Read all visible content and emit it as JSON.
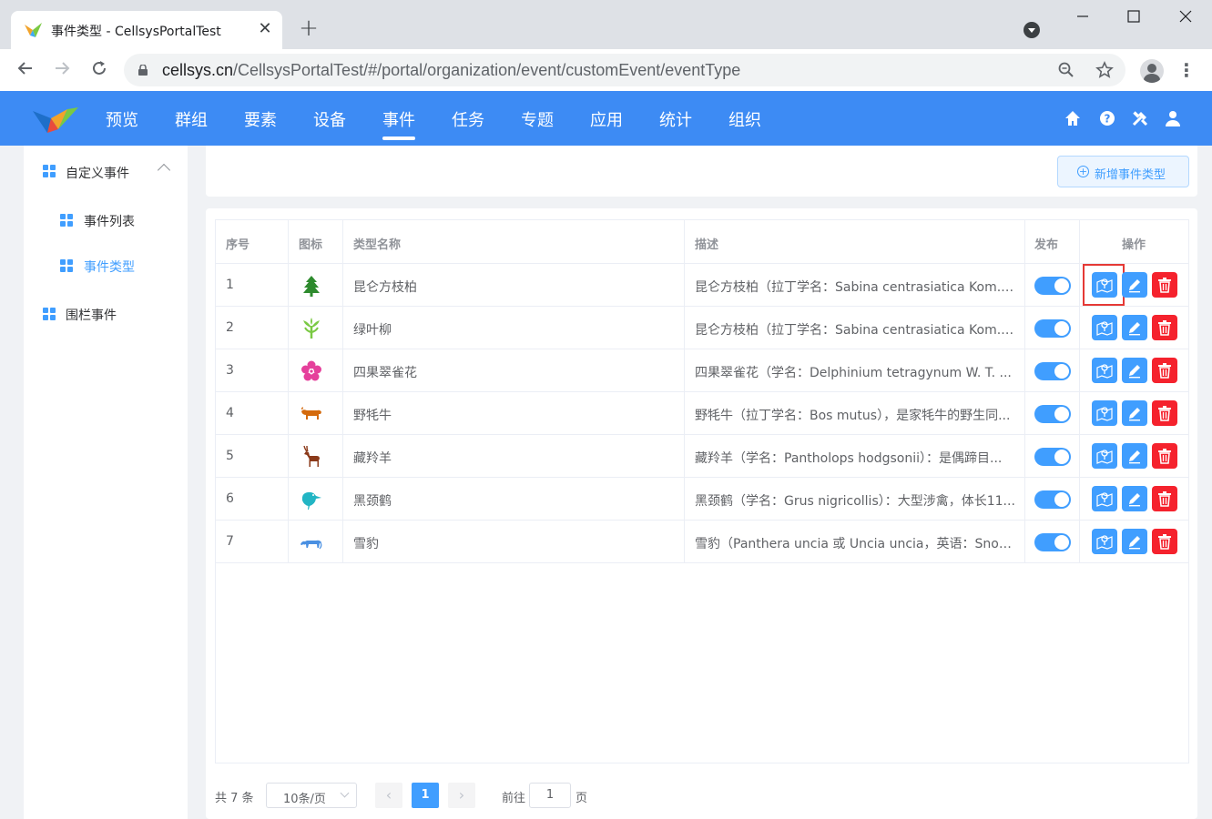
{
  "browser": {
    "tab_title": "事件类型 - CellsysPortalTest",
    "tab_close": "✕",
    "new_tab": "+",
    "url_host": "cellsys.cn",
    "url_path": "/CellsysPortalTest/#/portal/organization/event/customEvent/eventType"
  },
  "header": {
    "menu": [
      "预览",
      "群组",
      "要素",
      "设备",
      "事件",
      "任务",
      "专题",
      "应用",
      "统计",
      "组织"
    ],
    "active_menu": "事件"
  },
  "sidebar": {
    "group1": "自定义事件",
    "item1": "事件列表",
    "item2": "事件类型",
    "group2": "围栏事件"
  },
  "toolbar": {
    "add_button": "新增事件类型"
  },
  "table": {
    "headers": {
      "index": "序号",
      "icon": "图标",
      "name": "类型名称",
      "desc": "描述",
      "publish": "发布",
      "ops": "操作"
    },
    "rows": [
      {
        "index": "1",
        "icon": "tree-icon",
        "icon_color": "#2e8b2e",
        "name": "昆仑方枝柏",
        "desc": "昆仑方枝柏（拉丁学名：Sabina centrasiatica Kom.）...",
        "published": true
      },
      {
        "index": "2",
        "icon": "willow-icon",
        "icon_color": "#7ac943",
        "name": "绿叶柳",
        "desc": "昆仑方枝柏（拉丁学名：Sabina centrasiatica Kom.）...",
        "published": true
      },
      {
        "index": "3",
        "icon": "flower-icon",
        "icon_color": "#e5409b",
        "name": "四果翠雀花",
        "desc": "四果翠雀花（学名：Delphinium tetragynum W. T. ...",
        "published": true
      },
      {
        "index": "4",
        "icon": "yak-icon",
        "icon_color": "#d46a0c",
        "name": "野牦牛",
        "desc": "野牦牛（拉丁学名：Bos mutus），是家牦牛的野生同...",
        "published": true
      },
      {
        "index": "5",
        "icon": "antelope-icon",
        "icon_color": "#8b3a1a",
        "name": "藏羚羊",
        "desc": "藏羚羊（学名：Pantholops hodgsonii）：是偶蹄目...",
        "published": true
      },
      {
        "index": "6",
        "icon": "crane-icon",
        "icon_color": "#22b5c4",
        "name": "黑颈鹤",
        "desc": "黑颈鹤（学名：Grus nigricollis）：大型涉禽，体长11...",
        "published": true
      },
      {
        "index": "7",
        "icon": "leopard-icon",
        "icon_color": "#4a90e2",
        "name": "雪豹",
        "desc": "雪豹（Panthera uncia 或 Uncia uncia，英语：Snow ...",
        "published": true
      }
    ]
  },
  "pagination": {
    "total": "共 7 条",
    "page_size": "10条/页",
    "current_page": "1",
    "goto_label": "前往",
    "goto_value": "1",
    "page_label": "页"
  },
  "colors": {
    "primary": "#409eff",
    "header_bg": "#3d8bf4",
    "danger": "#f5222d",
    "highlight": "#e53935"
  }
}
